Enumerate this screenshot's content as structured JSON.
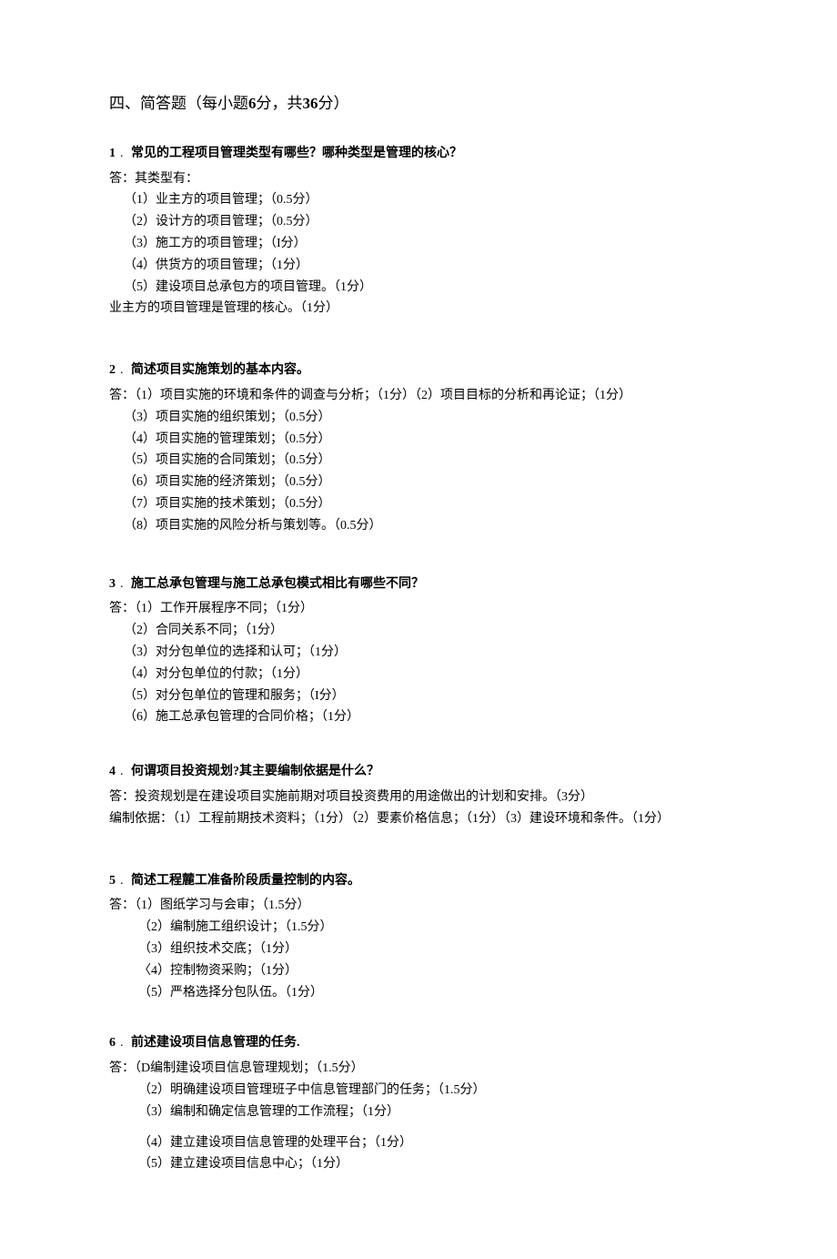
{
  "section_title_prefix": "四、简答题（每小题",
  "section_title_bold1": "6",
  "section_title_mid": "分，共",
  "section_title_bold2": "36",
  "section_title_suffix": "分）",
  "q1": {
    "num": "1",
    "dot": " .",
    "title": "常见的工程项目管理类型有哪些？哪种类型是管理的核心？",
    "a0": "答：其类型有：",
    "a1": "（1）业主方的项目管理；（0.5分）",
    "a2": "（2）设计方的项目管理；（0.5分）",
    "a3": "（3）施工方的项目管理；（I分）",
    "a4": "（4）供货方的项目管理；（1分）",
    "a5": "（5）建设项目总承包方的项目管理。（1分）",
    "a6": "业主方的项目管理是管理的核心。（1分）"
  },
  "q2": {
    "num": "2",
    "dot": " .",
    "title": "简述项目实施策划的基本内容。",
    "a0": "答：（1）项目实施的环境和条件的调查与分析；（1分）（2）项目目标的分析和再论证；（1分）",
    "a1": "（3）项目实施的组织策划；（0.5分）",
    "a2": "（4）项目实施的管理策划；（0.5分）",
    "a3": "（5）项目实施的合同策划；（0.5分）",
    "a4": "（6）项目实施的经济策划；（0.5分）",
    "a5": "（7）项目实施的技术策划；（0.5分）",
    "a6": "（8）项目实施的风险分析与策划等。（0.5分）"
  },
  "q3": {
    "num": "3",
    "dot": " .",
    "title": "施工总承包管理与施工总承包模式相比有哪些不同？",
    "a0": "答：（1）工作开展程序不同；（1分）",
    "a1": "（2）合同关系不同；（1分）",
    "a2": "（3）对分包单位的选择和认可；（1分）",
    "a3": "（4）对分包单位的付款；（1分）",
    "a4": "（5）对分包单位的管理和服务；（I分）",
    "a5": "（6）施工总承包管理的合同价格；（1分）"
  },
  "q4": {
    "num": "4",
    "dot": " .",
    "title": "何谓项目投资规划?其主要编制依据是什么？",
    "a0": "答：投资规划是在建设项目实施前期对项目投资费用的用途做出的计划和安排。（3分）",
    "a1": "编制依据：（1）工程前期技术资料；（1分）（2）要素价格信息；（1分）（3）建设环境和条件。（1分）"
  },
  "q5": {
    "num": "5",
    "dot": " .",
    "title": "简述工程麓工准备阶段质量控制的内容。",
    "a0": "答：（1）图纸学习与会审；（1.5分）",
    "a1": "（2）编制施工组织设计；（1.5分）",
    "a2": "（3）组织技术交底；（1分）",
    "a3": "〈4）控制物资采购；（1分）",
    "a4": "（5）严格选择分包队伍。（1分）"
  },
  "q6": {
    "num": "6",
    "dot": " .",
    "title": "前述建设项目信息管理的任务.",
    "a0": "答：（D编制建设项目信息管理规划；（1.5分）",
    "a1": "（2）明确建设项目管理班子中信息管理部门的任务；（1.5分）",
    "a2": "（3）编制和确定信息管理的工作流程；（1分）",
    "a3": "（4）建立建设项目信息管理的处理平台；（1分）",
    "a4": "（5）建立建设项目信息中心；（1分）"
  }
}
